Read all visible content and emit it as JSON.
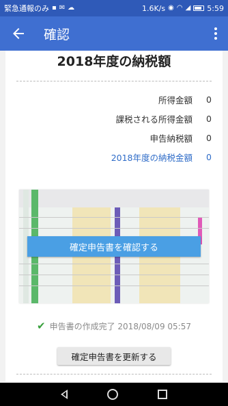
{
  "statusbar": {
    "carrier": "緊急通報のみ",
    "speed": "1.6K/s",
    "time": "5:59"
  },
  "appbar": {
    "title": "確認",
    "back_icon": "arrow-left-icon",
    "menu_icon": "more-vert-icon"
  },
  "summary": {
    "heading": "2018年度の納税額",
    "rows": [
      {
        "label": "所得金額",
        "value": "0"
      },
      {
        "label": "課税される所得金額",
        "value": "0"
      },
      {
        "label": "申告納税額",
        "value": "0"
      },
      {
        "label": "2018年度の納税金額",
        "value": "0"
      }
    ]
  },
  "preview": {
    "button_label": "確定申告書を確認する"
  },
  "status": {
    "text": "申告書の作成完了 2018/08/09 05:57",
    "icon": "check-icon",
    "color": "#38a03c"
  },
  "actions": {
    "update_label": "確定申告書を更新する"
  },
  "colors": {
    "appbar": "#3f6fd1",
    "statusbar": "#2f5ab8",
    "accent_text": "#2f6cc8",
    "primary_button": "#4a9fe4"
  }
}
